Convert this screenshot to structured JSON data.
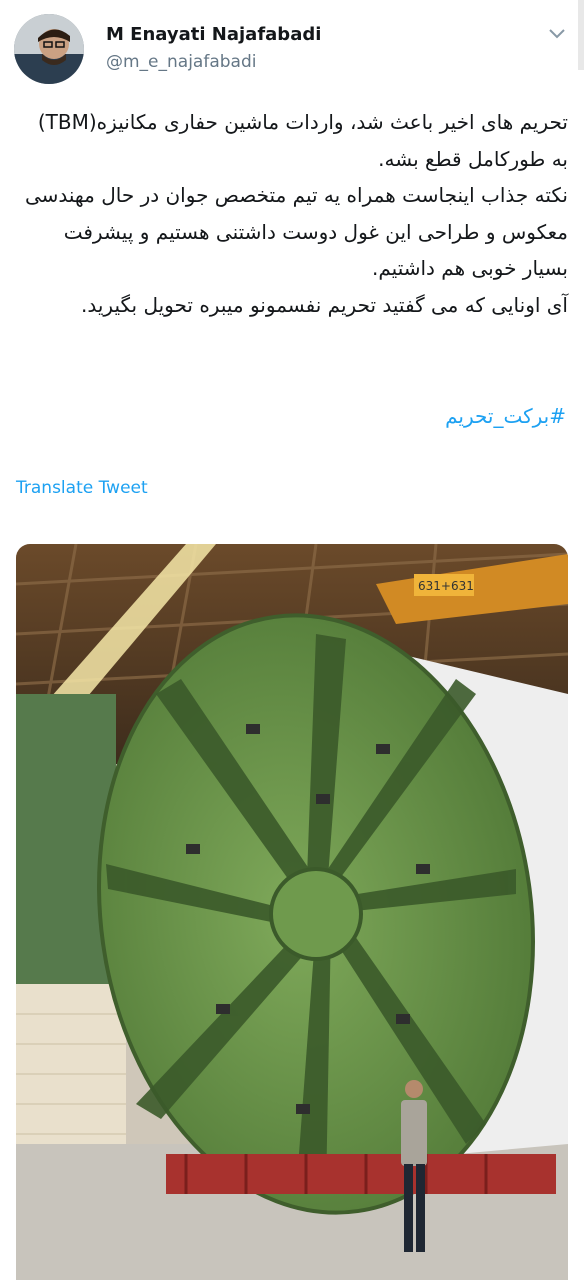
{
  "user": {
    "name": "M Enayati Najafabadi",
    "handle": "@m_e_najafabadi"
  },
  "tweet": {
    "text": "تحریم های اخیر باعث شد، واردات ماشین حفاری مکانیزه(TBM) به طورکامل قطع بشه.\nنکته جذاب اینجاست همراه یه تیم متخصص جوان در حال مهندسی معکوس و طراحی این غول دوست داشتنی هستیم و پیشرفت بسیار خوبی هم داشتیم.\nآی اونایی که می گفتید تحریم نفسمونو میبره تحویل بگیرید.",
    "hashtag": "#برکت_تحریم"
  },
  "translate_label": "Translate Tweet",
  "photo": {
    "sign_text": "631+631"
  },
  "colors": {
    "link": "#1da1f2",
    "secondary": "#657786",
    "machine": "#6e9a4e"
  }
}
